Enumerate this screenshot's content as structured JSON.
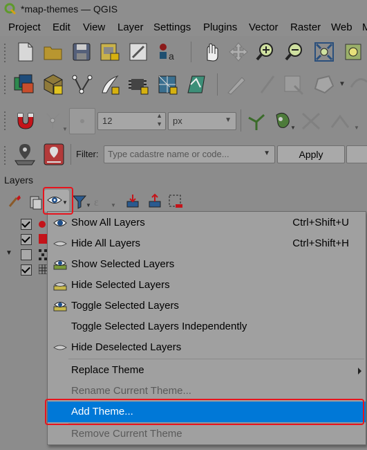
{
  "window": {
    "title": "*map-themes — QGIS"
  },
  "menubar": {
    "items": [
      "Project",
      "Edit",
      "View",
      "Layer",
      "Settings",
      "Plugins",
      "Vector",
      "Raster",
      "Web",
      "M"
    ]
  },
  "snapping": {
    "tolerance_value": "12",
    "unit": "px"
  },
  "filter": {
    "label": "Filter:",
    "placeholder": "Type cadastre name or code...",
    "apply_label": "Apply"
  },
  "layers_panel": {
    "title": "Layers"
  },
  "context_menu": {
    "items": [
      {
        "label": "Show All Layers",
        "shortcut": "Ctrl+Shift+U",
        "icon": "eye-icon"
      },
      {
        "label": "Hide All Layers",
        "shortcut": "Ctrl+Shift+H",
        "icon": "hidden-eye-icon"
      },
      {
        "label": "Show Selected Layers",
        "shortcut": "",
        "icon": "eye-layers-icon"
      },
      {
        "label": "Hide Selected Layers",
        "shortcut": "",
        "icon": "hidden-layers-icon"
      },
      {
        "label": "Toggle Selected Layers",
        "shortcut": "",
        "icon": "toggle-layers-icon"
      },
      {
        "label": "Toggle Selected Layers Independently",
        "shortcut": "",
        "icon": ""
      },
      {
        "label": "Hide Deselected Layers",
        "shortcut": "",
        "icon": "hidden-eye-icon"
      },
      {
        "label": "Replace Theme",
        "shortcut": "",
        "icon": ""
      },
      {
        "label": "Rename Current Theme...",
        "shortcut": "",
        "icon": ""
      },
      {
        "label": "Add Theme...",
        "shortcut": "",
        "icon": ""
      },
      {
        "label": "Remove Current Theme",
        "shortcut": "",
        "icon": ""
      }
    ]
  },
  "colors": {
    "highlight": "#0078d7",
    "annotation_red": "#e8141d"
  }
}
